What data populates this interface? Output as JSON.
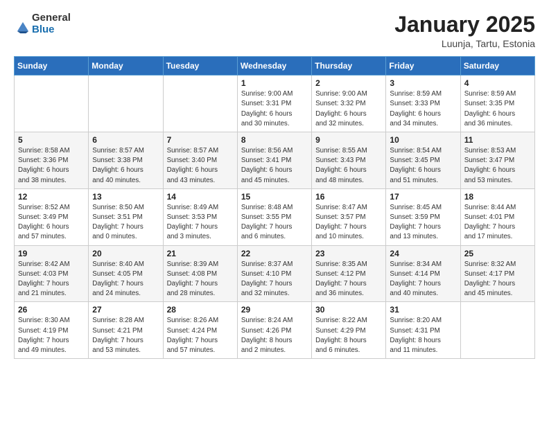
{
  "header": {
    "logo_general": "General",
    "logo_blue": "Blue",
    "month_title": "January 2025",
    "location": "Luunja, Tartu, Estonia"
  },
  "days_of_week": [
    "Sunday",
    "Monday",
    "Tuesday",
    "Wednesday",
    "Thursday",
    "Friday",
    "Saturday"
  ],
  "weeks": [
    [
      {
        "day": "",
        "info": ""
      },
      {
        "day": "",
        "info": ""
      },
      {
        "day": "",
        "info": ""
      },
      {
        "day": "1",
        "info": "Sunrise: 9:00 AM\nSunset: 3:31 PM\nDaylight: 6 hours\nand 30 minutes."
      },
      {
        "day": "2",
        "info": "Sunrise: 9:00 AM\nSunset: 3:32 PM\nDaylight: 6 hours\nand 32 minutes."
      },
      {
        "day": "3",
        "info": "Sunrise: 8:59 AM\nSunset: 3:33 PM\nDaylight: 6 hours\nand 34 minutes."
      },
      {
        "day": "4",
        "info": "Sunrise: 8:59 AM\nSunset: 3:35 PM\nDaylight: 6 hours\nand 36 minutes."
      }
    ],
    [
      {
        "day": "5",
        "info": "Sunrise: 8:58 AM\nSunset: 3:36 PM\nDaylight: 6 hours\nand 38 minutes."
      },
      {
        "day": "6",
        "info": "Sunrise: 8:57 AM\nSunset: 3:38 PM\nDaylight: 6 hours\nand 40 minutes."
      },
      {
        "day": "7",
        "info": "Sunrise: 8:57 AM\nSunset: 3:40 PM\nDaylight: 6 hours\nand 43 minutes."
      },
      {
        "day": "8",
        "info": "Sunrise: 8:56 AM\nSunset: 3:41 PM\nDaylight: 6 hours\nand 45 minutes."
      },
      {
        "day": "9",
        "info": "Sunrise: 8:55 AM\nSunset: 3:43 PM\nDaylight: 6 hours\nand 48 minutes."
      },
      {
        "day": "10",
        "info": "Sunrise: 8:54 AM\nSunset: 3:45 PM\nDaylight: 6 hours\nand 51 minutes."
      },
      {
        "day": "11",
        "info": "Sunrise: 8:53 AM\nSunset: 3:47 PM\nDaylight: 6 hours\nand 53 minutes."
      }
    ],
    [
      {
        "day": "12",
        "info": "Sunrise: 8:52 AM\nSunset: 3:49 PM\nDaylight: 6 hours\nand 57 minutes."
      },
      {
        "day": "13",
        "info": "Sunrise: 8:50 AM\nSunset: 3:51 PM\nDaylight: 7 hours\nand 0 minutes."
      },
      {
        "day": "14",
        "info": "Sunrise: 8:49 AM\nSunset: 3:53 PM\nDaylight: 7 hours\nand 3 minutes."
      },
      {
        "day": "15",
        "info": "Sunrise: 8:48 AM\nSunset: 3:55 PM\nDaylight: 7 hours\nand 6 minutes."
      },
      {
        "day": "16",
        "info": "Sunrise: 8:47 AM\nSunset: 3:57 PM\nDaylight: 7 hours\nand 10 minutes."
      },
      {
        "day": "17",
        "info": "Sunrise: 8:45 AM\nSunset: 3:59 PM\nDaylight: 7 hours\nand 13 minutes."
      },
      {
        "day": "18",
        "info": "Sunrise: 8:44 AM\nSunset: 4:01 PM\nDaylight: 7 hours\nand 17 minutes."
      }
    ],
    [
      {
        "day": "19",
        "info": "Sunrise: 8:42 AM\nSunset: 4:03 PM\nDaylight: 7 hours\nand 21 minutes."
      },
      {
        "day": "20",
        "info": "Sunrise: 8:40 AM\nSunset: 4:05 PM\nDaylight: 7 hours\nand 24 minutes."
      },
      {
        "day": "21",
        "info": "Sunrise: 8:39 AM\nSunset: 4:08 PM\nDaylight: 7 hours\nand 28 minutes."
      },
      {
        "day": "22",
        "info": "Sunrise: 8:37 AM\nSunset: 4:10 PM\nDaylight: 7 hours\nand 32 minutes."
      },
      {
        "day": "23",
        "info": "Sunrise: 8:35 AM\nSunset: 4:12 PM\nDaylight: 7 hours\nand 36 minutes."
      },
      {
        "day": "24",
        "info": "Sunrise: 8:34 AM\nSunset: 4:14 PM\nDaylight: 7 hours\nand 40 minutes."
      },
      {
        "day": "25",
        "info": "Sunrise: 8:32 AM\nSunset: 4:17 PM\nDaylight: 7 hours\nand 45 minutes."
      }
    ],
    [
      {
        "day": "26",
        "info": "Sunrise: 8:30 AM\nSunset: 4:19 PM\nDaylight: 7 hours\nand 49 minutes."
      },
      {
        "day": "27",
        "info": "Sunrise: 8:28 AM\nSunset: 4:21 PM\nDaylight: 7 hours\nand 53 minutes."
      },
      {
        "day": "28",
        "info": "Sunrise: 8:26 AM\nSunset: 4:24 PM\nDaylight: 7 hours\nand 57 minutes."
      },
      {
        "day": "29",
        "info": "Sunrise: 8:24 AM\nSunset: 4:26 PM\nDaylight: 8 hours\nand 2 minutes."
      },
      {
        "day": "30",
        "info": "Sunrise: 8:22 AM\nSunset: 4:29 PM\nDaylight: 8 hours\nand 6 minutes."
      },
      {
        "day": "31",
        "info": "Sunrise: 8:20 AM\nSunset: 4:31 PM\nDaylight: 8 hours\nand 11 minutes."
      },
      {
        "day": "",
        "info": ""
      }
    ]
  ]
}
